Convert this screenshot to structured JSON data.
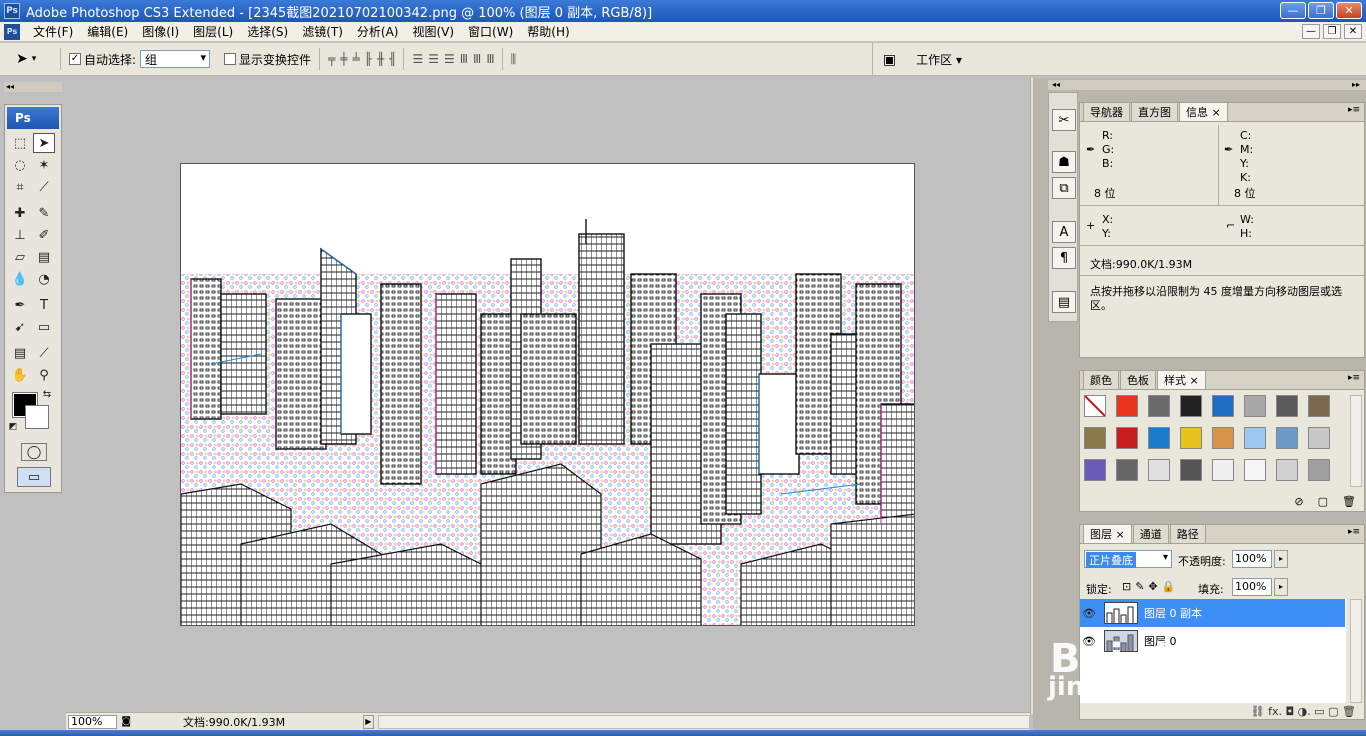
{
  "window": {
    "title": "Adobe Photoshop CS3 Extended - [2345截图20210702100342.png @ 100% (图层 0 副本, RGB/8)]",
    "app_icon": "Ps",
    "controls": {
      "minimize": "—",
      "restore": "❐",
      "close": "✕"
    }
  },
  "menubar": {
    "items": [
      "文件(F)",
      "编辑(E)",
      "图像(I)",
      "图层(L)",
      "选择(S)",
      "滤镜(T)",
      "分析(A)",
      "视图(V)",
      "窗口(W)",
      "帮助(H)"
    ]
  },
  "options": {
    "auto_select_label": "自动选择:",
    "auto_select_checked": "✓",
    "auto_select_value": "组",
    "show_transform_label": "显示变换控件",
    "workspace_label": "工作区 ▾"
  },
  "toolbox": {
    "logo": "Ps",
    "foreground_color": "#000000",
    "background_color": "#ffffff"
  },
  "statusbar": {
    "zoom": "100%",
    "doc_info": "文档:990.0K/1.93M"
  },
  "info_panel": {
    "tabs": [
      "导航器",
      "直方图",
      "信息 ×"
    ],
    "rgb": {
      "r": "R:",
      "g": "G:",
      "b": "B:",
      "bits": "8 位"
    },
    "cmyk": {
      "c": "C:",
      "m": "M:",
      "y": "Y:",
      "k": "K:",
      "bits": "8 位"
    },
    "xy": {
      "x": "X:",
      "y": "Y:"
    },
    "wh": {
      "w": "W:",
      "h": "H:"
    },
    "doc": "文档:990.0K/1.93M",
    "hint": "点按并拖移以沿限制为 45 度增量方向移动图层或选区。"
  },
  "styles_panel": {
    "tabs": [
      "颜色",
      "色板",
      "样式 ×"
    ],
    "swatches": [
      "#ffffff",
      "#e8341c",
      "#6a6a6a",
      "#222222",
      "#1e6fc4",
      "#a8a8a8",
      "#5a5a5a",
      "#7a6a50",
      "#8a7a4a",
      "#c81e1e",
      "#1a7acc",
      "#e6c21a",
      "#d8944a",
      "#9cc8f0",
      "#6a9ac8",
      "#c8c8c8",
      "#6a5ab8",
      "#666666",
      "#e0e0e0",
      "#555555",
      "#f0f0f0",
      "#f6f6f6",
      "#d0d0d0",
      "#a0a0a0"
    ]
  },
  "layers_panel": {
    "tabs": [
      "图层 ×",
      "通道",
      "路径"
    ],
    "blend_mode": "正片叠底",
    "opacity_label": "不透明度:",
    "opacity_value": "100%",
    "lock_label": "锁定:",
    "fill_label": "填充:",
    "fill_value": "100%",
    "layers": [
      {
        "name": "图层 0 副本",
        "selected": true
      },
      {
        "name": "图层 0",
        "selected": false
      }
    ],
    "footer_icons": "⛓  fx.  ◘  ◑.  ▭  ▢  🗑"
  },
  "watermark": {
    "brand": "Bai du 经验",
    "url": "jingyan.baidu.com"
  }
}
